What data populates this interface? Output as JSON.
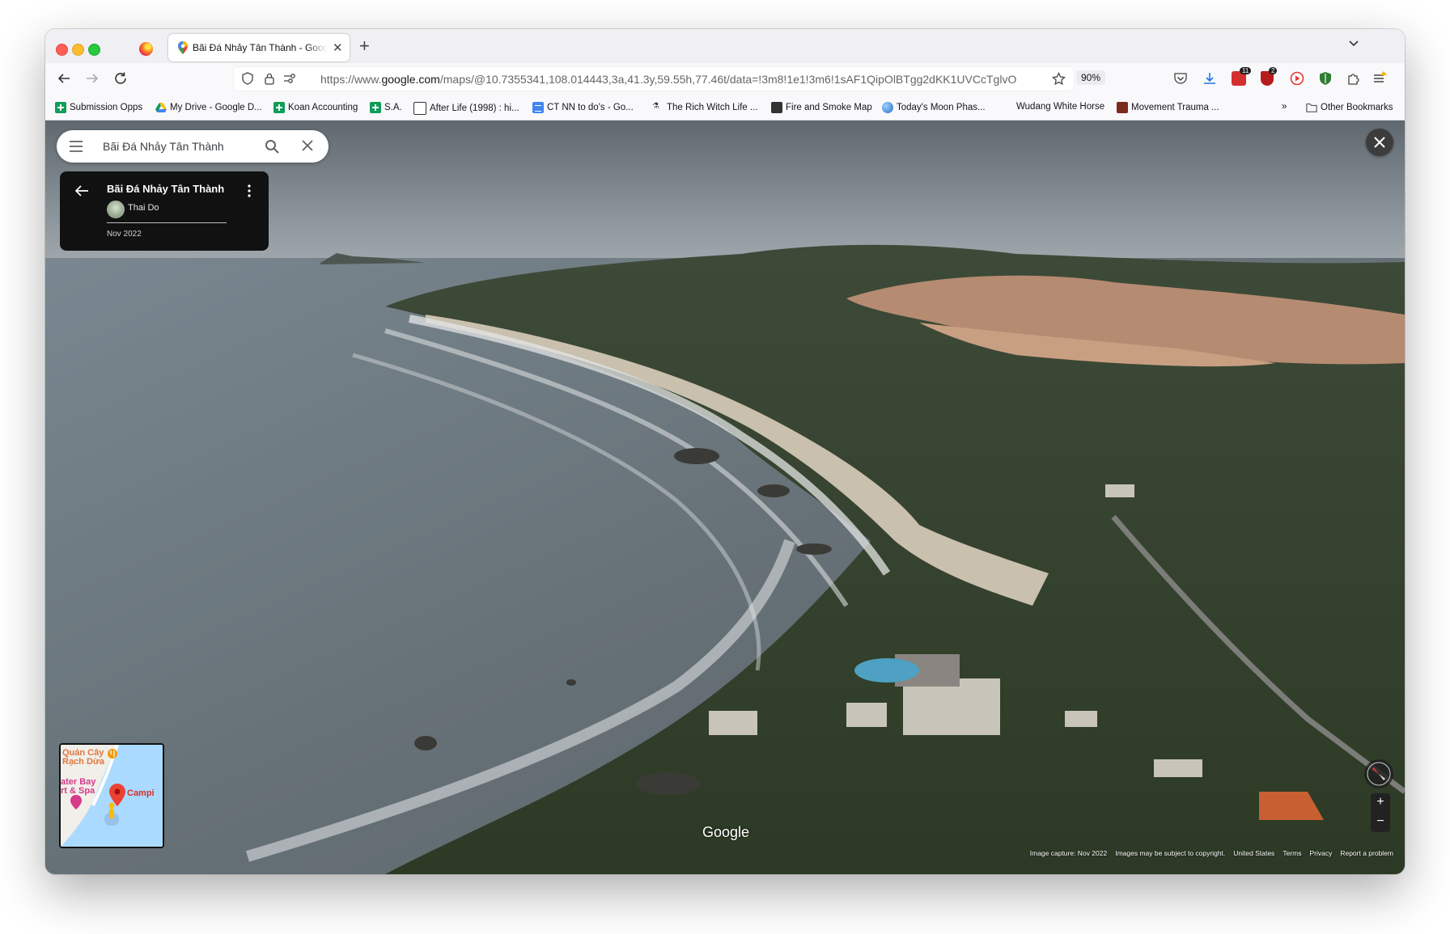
{
  "tab": {
    "title": "Bãi Đá Nhảy Tân Thành - Google Maps"
  },
  "url": {
    "prefix": "https://www.",
    "host": "google.com",
    "path": "/maps/@10.7355341,108.014443,3a,41.3y,59.55h,77.46t/data=!3m8!1e1!3m6!1sAF1QipOlBTgg2dKK1UVCcTglvO"
  },
  "zoom": "90%",
  "toolbar_badges": {
    "todo": "11",
    "ublock": "2"
  },
  "bookmarks": [
    {
      "label": "Submission Opps",
      "icon": "sheet"
    },
    {
      "label": "My Drive - Google D...",
      "icon": "drive"
    },
    {
      "label": "Koan Accounting",
      "icon": "sheet"
    },
    {
      "label": "S.A.",
      "icon": "sheet"
    },
    {
      "label": "After Life (1998) : hi...",
      "icon": "imdb"
    },
    {
      "label": "CT NN to do's - Go...",
      "icon": "doc"
    },
    {
      "label": "The Rich Witch Life ...",
      "icon": "witch"
    },
    {
      "label": "Fire and Smoke Map",
      "icon": "fire"
    },
    {
      "label": "Today's Moon Phas...",
      "icon": "moon"
    },
    {
      "label": "Wudang White Horse",
      "icon": "none"
    },
    {
      "label": "Movement Trauma ...",
      "icon": "trauma"
    }
  ],
  "other_bookmarks": "Other Bookmarks",
  "search": {
    "query": "Bãi Đá Nhảy Tân Thành"
  },
  "info": {
    "name": "Bãi Đá Nhảy Tân Thành",
    "author": "Thai Do",
    "date": "Nov 2022"
  },
  "minimap": {
    "label1": "Quán Cây",
    "label2": "Rạch Dừa",
    "label3": "ater Bay",
    "label4": "rt & Spa",
    "label5": "Campi"
  },
  "google_logo": "Google",
  "footer": {
    "capture": "Image capture: Nov 2022",
    "copyright": "Images may be subject to copyright.",
    "country": "United States",
    "terms": "Terms",
    "privacy": "Privacy",
    "report": "Report a problem"
  },
  "zoom_controls": {
    "plus": "+",
    "minus": "−"
  }
}
